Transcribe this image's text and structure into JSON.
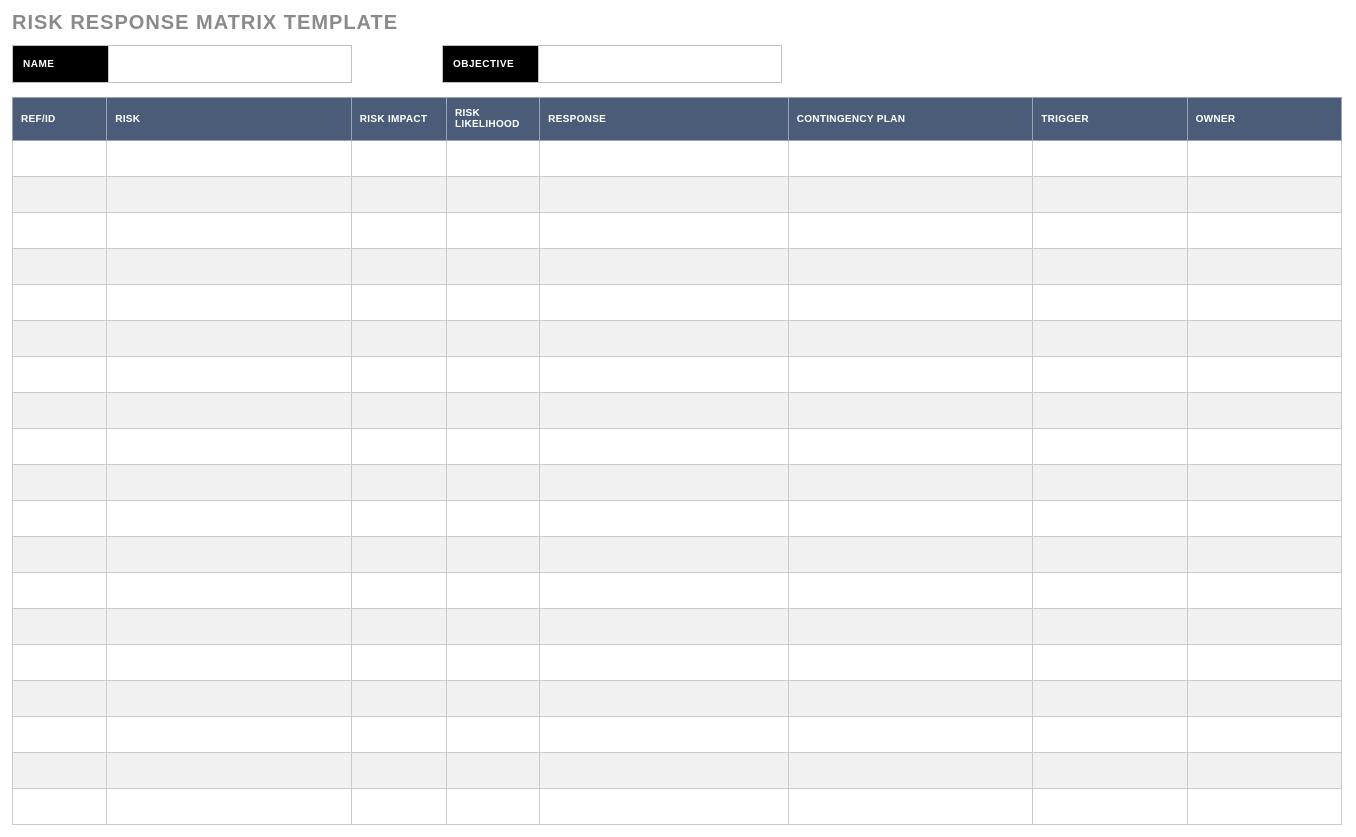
{
  "title": "RISK RESPONSE MATRIX TEMPLATE",
  "meta": {
    "name_label": "NAME",
    "name_value": "",
    "objective_label": "OBJECTIVE",
    "objective_value": ""
  },
  "table": {
    "headers": {
      "ref_id": "REF/ID",
      "risk": "RISK",
      "risk_impact": "RISK IMPACT",
      "risk_likelihood": "RISK LIKELIHOOD",
      "response": "RESPONSE",
      "contingency": "CONTINGENCY PLAN",
      "trigger": "TRIGGER",
      "owner": "OWNER"
    },
    "rows": [
      {
        "ref_id": "",
        "risk": "",
        "risk_impact": "",
        "risk_likelihood": "",
        "response": "",
        "contingency": "",
        "trigger": "",
        "owner": ""
      },
      {
        "ref_id": "",
        "risk": "",
        "risk_impact": "",
        "risk_likelihood": "",
        "response": "",
        "contingency": "",
        "trigger": "",
        "owner": ""
      },
      {
        "ref_id": "",
        "risk": "",
        "risk_impact": "",
        "risk_likelihood": "",
        "response": "",
        "contingency": "",
        "trigger": "",
        "owner": ""
      },
      {
        "ref_id": "",
        "risk": "",
        "risk_impact": "",
        "risk_likelihood": "",
        "response": "",
        "contingency": "",
        "trigger": "",
        "owner": ""
      },
      {
        "ref_id": "",
        "risk": "",
        "risk_impact": "",
        "risk_likelihood": "",
        "response": "",
        "contingency": "",
        "trigger": "",
        "owner": ""
      },
      {
        "ref_id": "",
        "risk": "",
        "risk_impact": "",
        "risk_likelihood": "",
        "response": "",
        "contingency": "",
        "trigger": "",
        "owner": ""
      },
      {
        "ref_id": "",
        "risk": "",
        "risk_impact": "",
        "risk_likelihood": "",
        "response": "",
        "contingency": "",
        "trigger": "",
        "owner": ""
      },
      {
        "ref_id": "",
        "risk": "",
        "risk_impact": "",
        "risk_likelihood": "",
        "response": "",
        "contingency": "",
        "trigger": "",
        "owner": ""
      },
      {
        "ref_id": "",
        "risk": "",
        "risk_impact": "",
        "risk_likelihood": "",
        "response": "",
        "contingency": "",
        "trigger": "",
        "owner": ""
      },
      {
        "ref_id": "",
        "risk": "",
        "risk_impact": "",
        "risk_likelihood": "",
        "response": "",
        "contingency": "",
        "trigger": "",
        "owner": ""
      },
      {
        "ref_id": "",
        "risk": "",
        "risk_impact": "",
        "risk_likelihood": "",
        "response": "",
        "contingency": "",
        "trigger": "",
        "owner": ""
      },
      {
        "ref_id": "",
        "risk": "",
        "risk_impact": "",
        "risk_likelihood": "",
        "response": "",
        "contingency": "",
        "trigger": "",
        "owner": ""
      },
      {
        "ref_id": "",
        "risk": "",
        "risk_impact": "",
        "risk_likelihood": "",
        "response": "",
        "contingency": "",
        "trigger": "",
        "owner": ""
      },
      {
        "ref_id": "",
        "risk": "",
        "risk_impact": "",
        "risk_likelihood": "",
        "response": "",
        "contingency": "",
        "trigger": "",
        "owner": ""
      },
      {
        "ref_id": "",
        "risk": "",
        "risk_impact": "",
        "risk_likelihood": "",
        "response": "",
        "contingency": "",
        "trigger": "",
        "owner": ""
      },
      {
        "ref_id": "",
        "risk": "",
        "risk_impact": "",
        "risk_likelihood": "",
        "response": "",
        "contingency": "",
        "trigger": "",
        "owner": ""
      },
      {
        "ref_id": "",
        "risk": "",
        "risk_impact": "",
        "risk_likelihood": "",
        "response": "",
        "contingency": "",
        "trigger": "",
        "owner": ""
      },
      {
        "ref_id": "",
        "risk": "",
        "risk_impact": "",
        "risk_likelihood": "",
        "response": "",
        "contingency": "",
        "trigger": "",
        "owner": ""
      },
      {
        "ref_id": "",
        "risk": "",
        "risk_impact": "",
        "risk_likelihood": "",
        "response": "",
        "contingency": "",
        "trigger": "",
        "owner": ""
      }
    ]
  }
}
